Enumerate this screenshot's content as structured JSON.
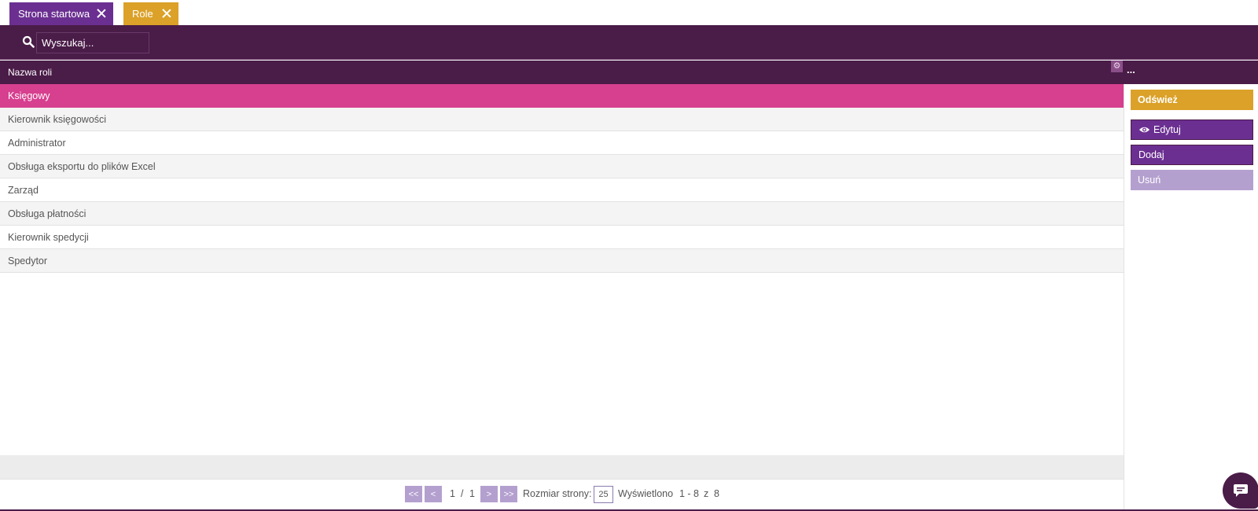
{
  "tabs": [
    {
      "label": "Strona startowa",
      "color": "#6b2f91"
    },
    {
      "label": "Role",
      "color": "#dba128"
    }
  ],
  "search": {
    "value": "Wyszukaj..."
  },
  "grid": {
    "column_header": "Nazwa roli",
    "more_label": "...",
    "rows": [
      "Księgowy",
      "Kierownik księgowości",
      "Administrator",
      "Obsługa eksportu do plików Excel",
      "Zarząd",
      "Obsługa płatności",
      "Kierownik spedycji",
      "Spedytor"
    ],
    "selected_index": 0
  },
  "pager": {
    "first": "<<",
    "prev": "<",
    "page": "1",
    "sep": "/",
    "pages": "1",
    "next": ">",
    "last": ">>",
    "page_size_label": "Rozmiar strony:",
    "page_size": "25",
    "shown_label": "Wyświetlono",
    "shown_range": "1 - 8",
    "of_label": "z",
    "total": "8"
  },
  "actions": {
    "refresh": "Odśwież",
    "edit": "Edytuj",
    "add": "Dodaj",
    "remove": "Usuń"
  },
  "colors": {
    "primary": "#4a1c48",
    "accent_purple": "#6b2f91",
    "accent_gold": "#dba128",
    "selected_row": "#d73f8f",
    "disabled": "#b4a0cf"
  },
  "icons": [
    "close-icon",
    "search-icon",
    "gear-icon",
    "eye-icon",
    "chat-icon"
  ]
}
